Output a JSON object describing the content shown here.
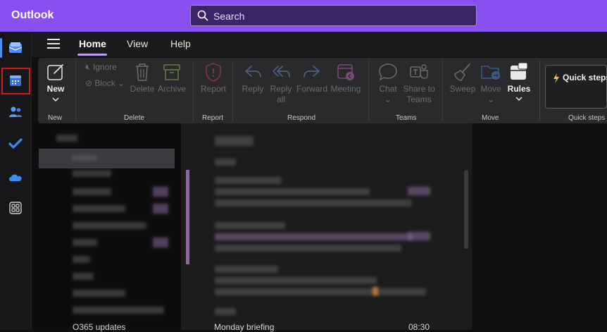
{
  "header": {
    "app_title": "Outlook",
    "search_placeholder": "Search"
  },
  "rail": {
    "items": [
      {
        "name": "mail-icon",
        "active": true
      },
      {
        "name": "calendar-icon",
        "active": false
      },
      {
        "name": "people-icon",
        "active": false
      },
      {
        "name": "todo-icon",
        "active": false
      },
      {
        "name": "onedrive-icon",
        "active": false
      },
      {
        "name": "apps-icon",
        "active": false
      }
    ]
  },
  "menu": {
    "tabs": [
      {
        "label": "Home",
        "active": true
      },
      {
        "label": "View",
        "active": false
      },
      {
        "label": "Help",
        "active": false
      }
    ]
  },
  "ribbon": {
    "new": {
      "label": "New",
      "group": "New"
    },
    "delete_group": {
      "ignore": "Ignore",
      "block": "Block",
      "delete": "Delete",
      "archive": "Archive",
      "group": "Delete"
    },
    "report": {
      "label": "Report",
      "group": "Report"
    },
    "respond": {
      "reply": "Reply",
      "reply_all_1": "Reply",
      "reply_all_2": "all",
      "forward": "Forward",
      "meeting": "Meeting",
      "group": "Respond"
    },
    "teams": {
      "chat": "Chat",
      "share_1": "Share to",
      "share_2": "Teams",
      "group": "Teams"
    },
    "move": {
      "sweep": "Sweep",
      "move": "Move",
      "rules": "Rules",
      "group": "Move"
    },
    "quick_steps": {
      "label": "Quick steps",
      "group": "Quick steps"
    }
  },
  "folders": {
    "bottom_folder": "O365 updates"
  },
  "messages": {
    "bottom_subject": "Monday briefing",
    "bottom_time": "08:30"
  },
  "colors": {
    "brand": "#8a4ff0",
    "accent_blue": "#4f8ef7",
    "highlight_red": "#d11a1a"
  }
}
